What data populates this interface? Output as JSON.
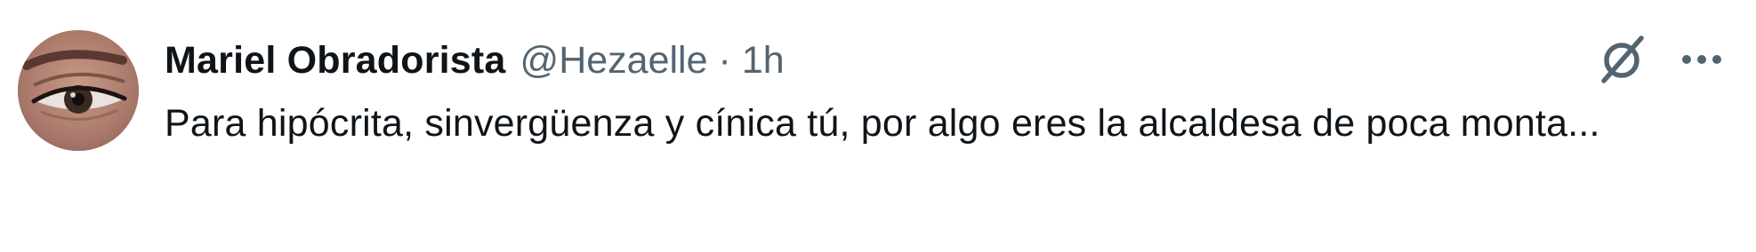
{
  "tweet": {
    "author": {
      "display_name": "Mariel Obradorista",
      "handle": "@Hezaelle"
    },
    "separator": "·",
    "time": "1h",
    "text": "Para hipócrita, sinvergüenza y cínica tú, por algo eres la alcaldesa de poca monta...",
    "icons": {
      "grok": "grok-icon",
      "more": "more-dots-icon"
    },
    "colors": {
      "primary_text": "#0f1419",
      "secondary_text": "#536471",
      "icon": "#536471"
    }
  }
}
